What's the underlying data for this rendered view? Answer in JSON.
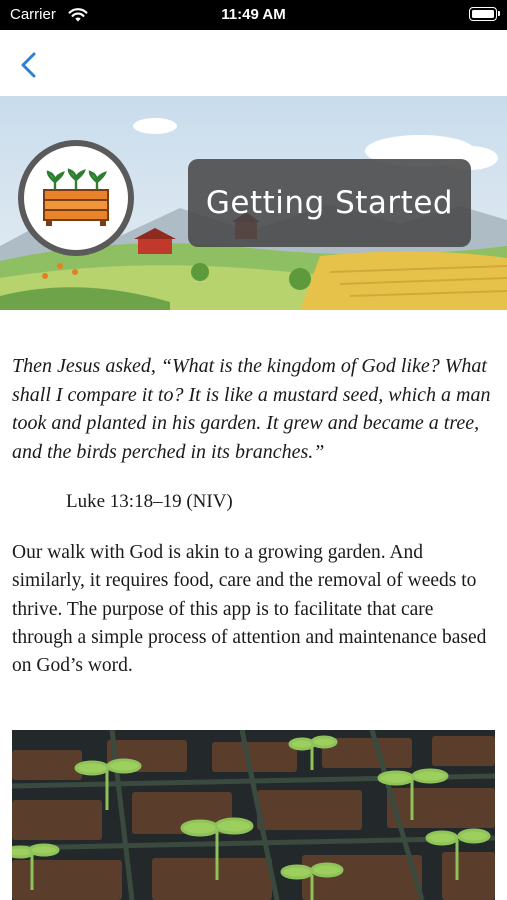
{
  "status_bar": {
    "carrier": "Carrier",
    "time": "11:49 AM",
    "wifi_icon": "wifi-icon",
    "battery_icon": "battery-icon"
  },
  "nav": {
    "back_icon": "chevron-left-icon",
    "accent_color": "#2f7fd8"
  },
  "banner": {
    "title": "Getting Started",
    "logo_icon": "seedling-planter-icon"
  },
  "content": {
    "quote": "Then Jesus asked, “What is the kingdom of God like? What shall I compare it to? It is like a mustard seed, which a man took and planted in his garden. It grew and became a tree, and the birds perched in its branches.”",
    "reference": "Luke 13:18–19 (NIV)",
    "body": "Our walk with God is akin to a growing garden. And similarly, it requires food, care and the removal of weeds to thrive. The purpose of this app is to facilitate that care through a simple process of attention and maintenance based on God’s word."
  }
}
